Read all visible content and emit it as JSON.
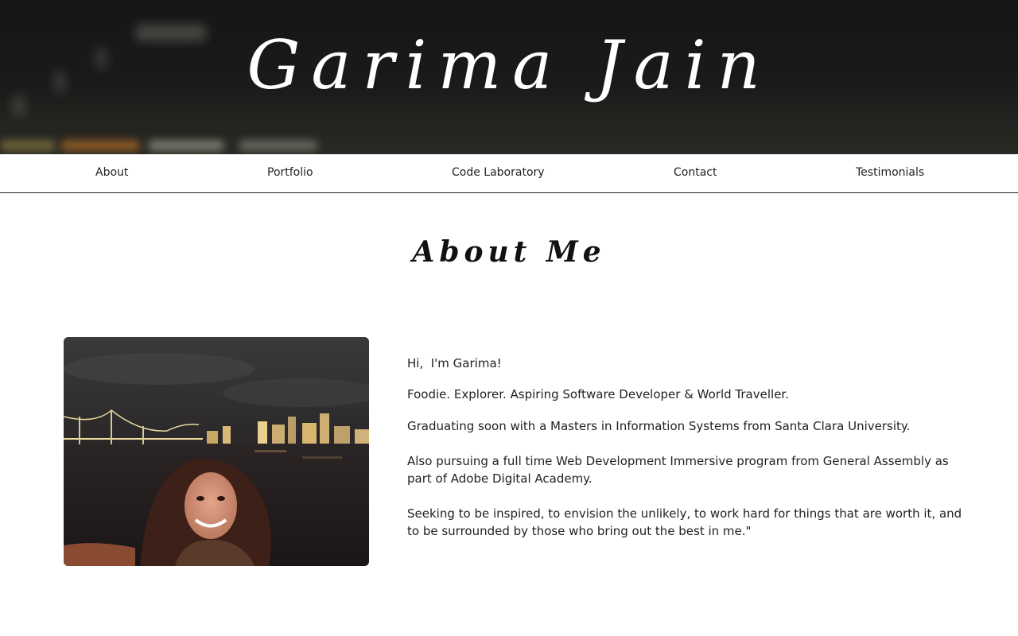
{
  "header": {
    "title": "Garima Jain"
  },
  "nav": {
    "items": [
      {
        "label": "About"
      },
      {
        "label": "Portfolio"
      },
      {
        "label": "Code Laboratory"
      },
      {
        "label": "Contact"
      },
      {
        "label": "Testimonials"
      }
    ]
  },
  "about": {
    "heading": "About Me",
    "greeting": "Hi,  I'm Garima!",
    "tagline": "Foodie. Explorer. Aspiring Software Developer & World Traveller.",
    "education": "Graduating soon with a Masters in Information Systems from Santa Clara University.",
    "program": "Also pursuing a full time Web Development Immersive program from General Assembly as part of Adobe Digital Academy.",
    "quote": "Seeking to be inspired, to envision the unlikely, to work hard for things that are worth it, and to be surrounded by those who bring out the best in me.\""
  },
  "colors": {
    "header_bg": "#151615",
    "text": "#222222",
    "nav_border": "#222222"
  }
}
